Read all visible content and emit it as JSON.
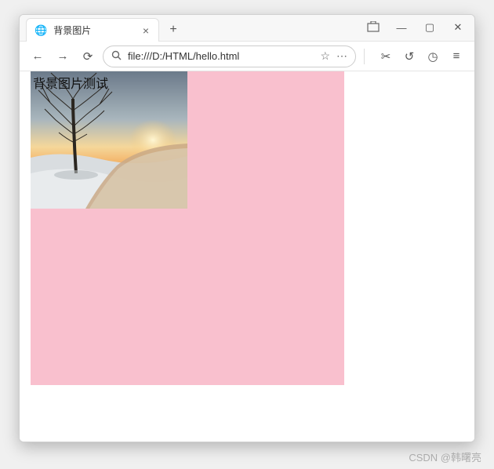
{
  "window": {
    "tab_title": "背景图片",
    "new_tab_label": "+",
    "minimize": "—",
    "maximize": "▢",
    "close": "✕"
  },
  "toolbar": {
    "back": "←",
    "forward": "→",
    "reload": "⟳",
    "url": "file:///D:/HTML/hello.html",
    "star": "☆",
    "more": "⋯",
    "scissors": "✂",
    "undo": "↺",
    "clock": "◷",
    "menu": "≡"
  },
  "page": {
    "heading": "背景图片测试",
    "box_color": "#f9c0ce",
    "bg_image_alt": "winter-tree-sunset"
  },
  "watermark": "CSDN @韩曙亮"
}
